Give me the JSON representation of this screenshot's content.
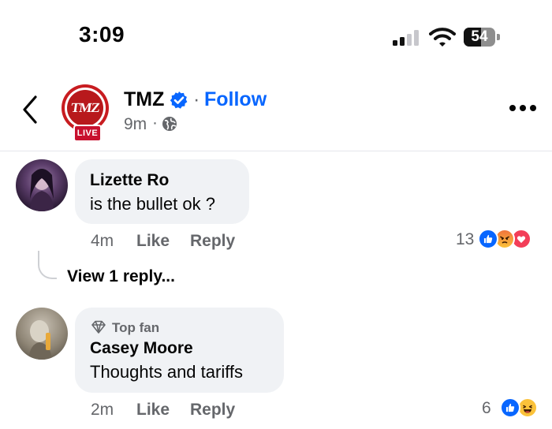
{
  "status_bar": {
    "time": "3:09",
    "battery_percent": "54",
    "signal_bars_active": 2
  },
  "header": {
    "page_name": "TMZ",
    "separator": "·",
    "follow_label": "Follow",
    "post_age": "9m",
    "time_separator": "·",
    "avatar_logo_text": "TMZ",
    "live_badge": "LIVE",
    "icons": [
      "back-chevron-icon",
      "verified-badge-icon",
      "globe-icon",
      "more-options-icon"
    ]
  },
  "comments": [
    {
      "author": "Lizette Ro",
      "text": "is the bullet ok ?",
      "age": "4m",
      "like_label": "Like",
      "reply_label": "Reply",
      "reaction_count": "13",
      "reactions": [
        "like",
        "angry",
        "love"
      ],
      "view_replies_label": "View 1 reply..."
    },
    {
      "badge_label": "Top fan",
      "author": "Casey Moore",
      "text": "Thoughts and tariffs",
      "age": "2m",
      "like_label": "Like",
      "reply_label": "Reply",
      "reaction_count": "6",
      "reactions": [
        "like",
        "haha"
      ]
    }
  ],
  "colors": {
    "accent_blue": "#0866ff",
    "tmz_red": "#c81c20",
    "secondary_text": "#65676b",
    "bubble_bg": "#f0f2f5",
    "angry_orange": "#f0743c",
    "love_red": "#f33e58",
    "haha_yellow": "#fbc23a"
  }
}
